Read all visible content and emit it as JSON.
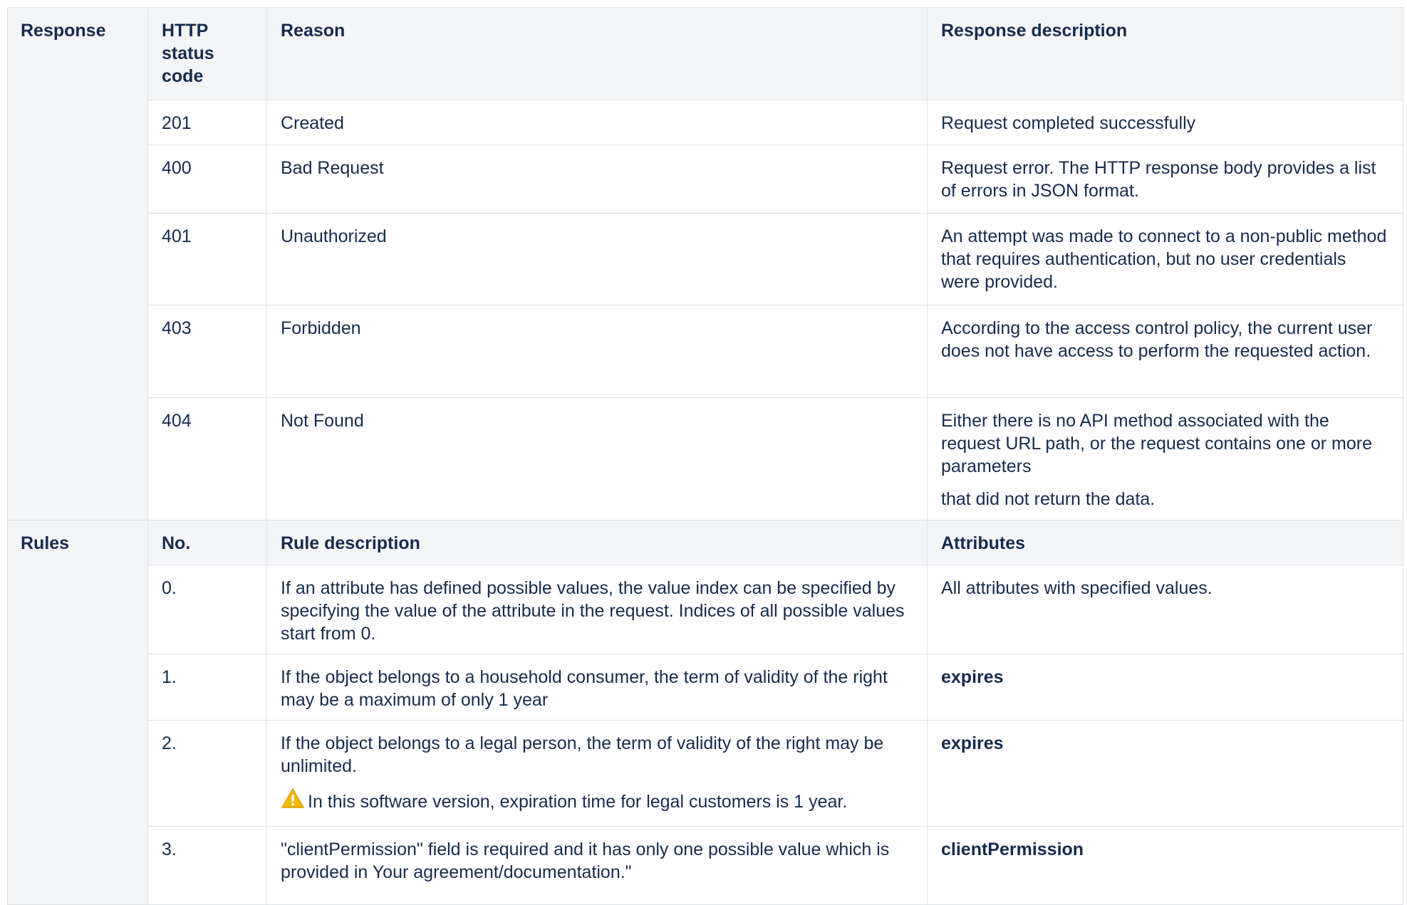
{
  "response_section": {
    "label": "Response",
    "headers": {
      "code": "HTTP status code",
      "reason": "Reason",
      "description": "Response description"
    },
    "rows": [
      {
        "code": "201",
        "reason": "Created",
        "description": "Request completed successfully",
        "description_extra": ""
      },
      {
        "code": "400",
        "reason": "Bad Request",
        "description": "Request error. The HTTP response body provides a list of errors in JSON format.",
        "description_extra": ""
      },
      {
        "code": "401",
        "reason": "Unauthorized",
        "description": "An attempt was made to connect to a non-public method that requires authentication, but no user credentials were provided.",
        "description_extra": ""
      },
      {
        "code": "403",
        "reason": "Forbidden",
        "description": "According to the access control policy, the current user does not have access to perform the requested action.",
        "description_extra": ""
      },
      {
        "code": "404",
        "reason": "Not Found",
        "description": "Either there is no API method associated with the request URL path, or the request contains one or more parameters",
        "description_extra": "that did not return the data."
      }
    ]
  },
  "rules_section": {
    "label": "Rules",
    "headers": {
      "number": "No.",
      "description": "Rule description",
      "attributes": "Attributes"
    },
    "rows": [
      {
        "number": "0.",
        "description": "If an attribute has defined possible values, the value index can be specified by specifying the value of the attribute in the request. Indices of all possible values start from 0.",
        "note": "",
        "attributes": "All attributes with specified values.",
        "attributes_bold": false
      },
      {
        "number": "1.",
        "description": "If the object belongs to a household consumer, the term of validity of the right may be a maximum of only 1 year",
        "note": "",
        "attributes": "expires",
        "attributes_bold": true
      },
      {
        "number": "2.",
        "description": "If the object belongs to a legal person, the term of validity of the right may be unlimited.",
        "note": "In this software version, expiration time for legal customers is 1 year.",
        "note_icon": "warning-icon",
        "attributes": "expires",
        "attributes_bold": true
      },
      {
        "number": "3.",
        "description": "\"clientPermission\" field is required and it has only one possible value which is provided in Your agreement/documentation.\"",
        "note": "",
        "attributes": "clientPermission",
        "attributes_bold": true
      }
    ]
  },
  "colors": {
    "header_bg": "#f4f5f7",
    "border": "#dfe1e6",
    "text": "#172b4d",
    "warning": "#f5b800"
  }
}
